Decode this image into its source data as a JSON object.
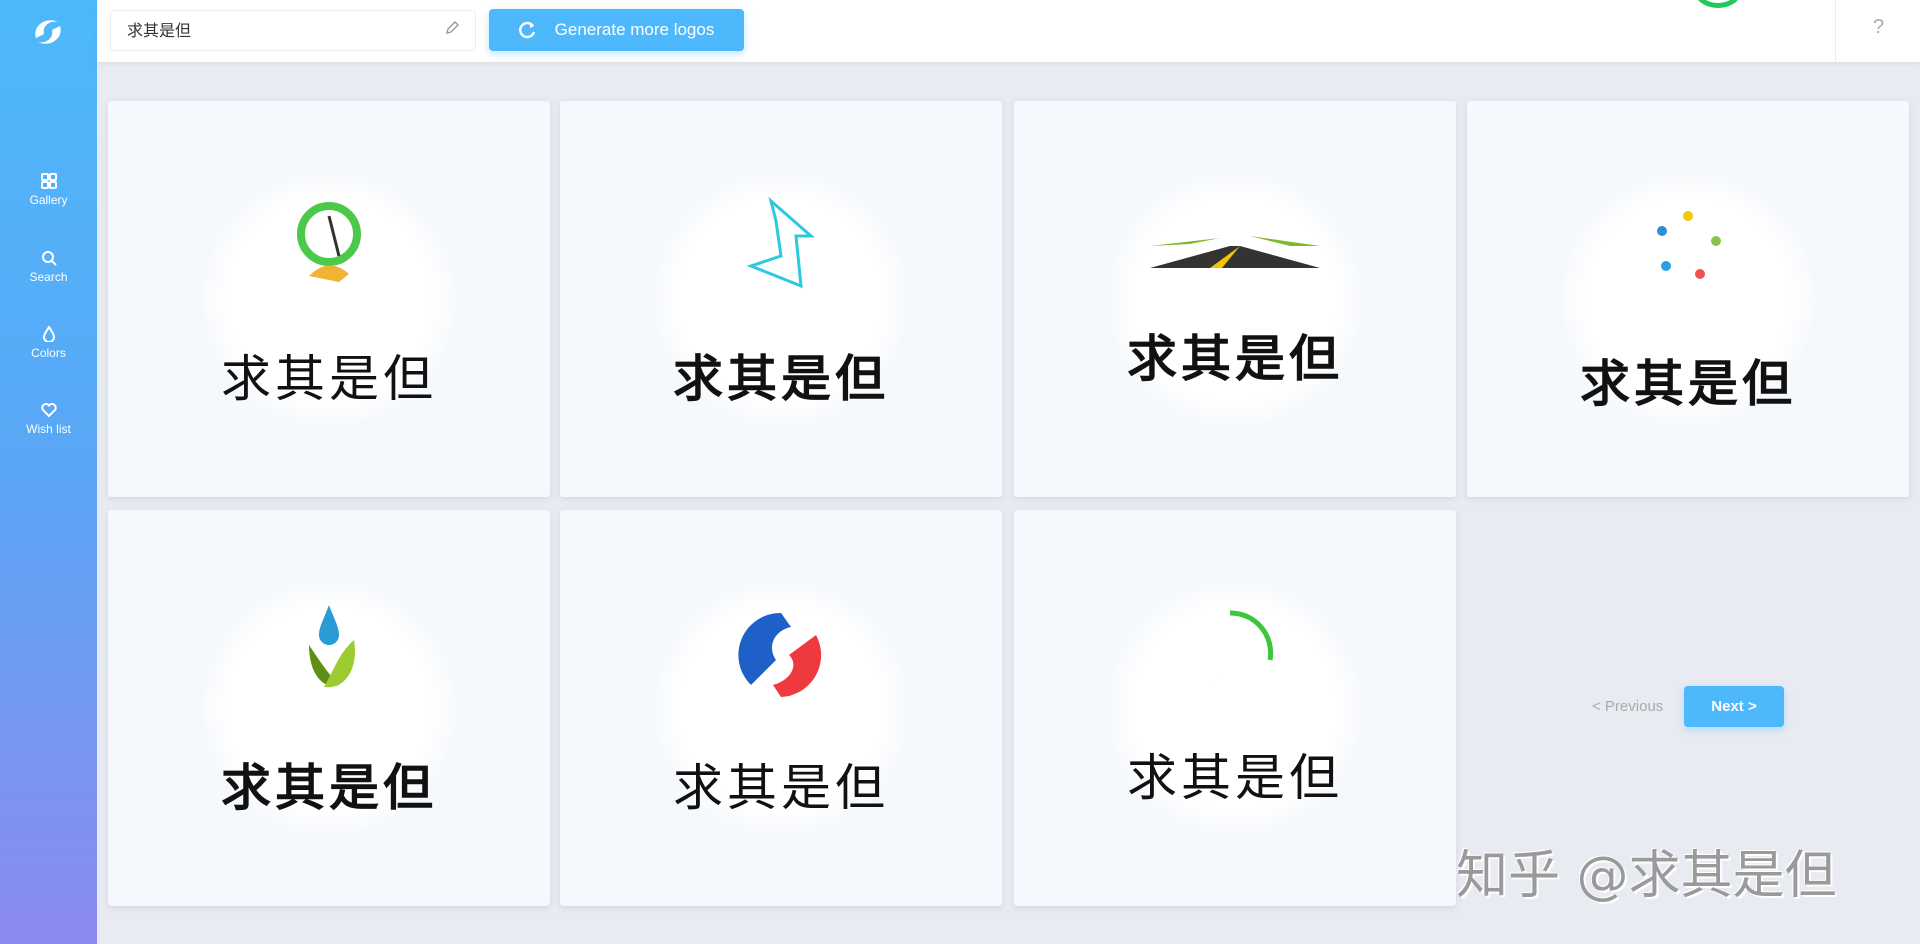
{
  "app": {
    "logo": "swirl-logo"
  },
  "sidebar": {
    "items": [
      {
        "label": "Gallery",
        "icon": "grid-icon"
      },
      {
        "label": "Search",
        "icon": "search-icon"
      },
      {
        "label": "Colors",
        "icon": "droplet-icon"
      },
      {
        "label": "Wish list",
        "icon": "heart-icon"
      }
    ]
  },
  "topbar": {
    "name_value": "求其是但",
    "generate_label": "Generate more logos",
    "help": "?"
  },
  "cards": [
    {
      "text": "求其是但",
      "icon": "tree-person-logo"
    },
    {
      "text": "求其是但",
      "icon": "arrow-logo"
    },
    {
      "text": "求其是但",
      "icon": "road-logo"
    },
    {
      "text": "求其是但",
      "icon": "people-circle-logo"
    },
    {
      "text": "求其是但",
      "icon": "water-leaf-logo"
    },
    {
      "text": "求其是但",
      "icon": "blue-red-swirl-logo"
    },
    {
      "text": "求其是但",
      "icon": "gray-green-swirl-logo"
    }
  ],
  "pagination": {
    "previous": "< Previous",
    "next": "Next >"
  },
  "watermark": "知乎 @求其是但",
  "colors": {
    "accent": "#4db8fb",
    "sidebar_bottom": "#8c8af0"
  }
}
